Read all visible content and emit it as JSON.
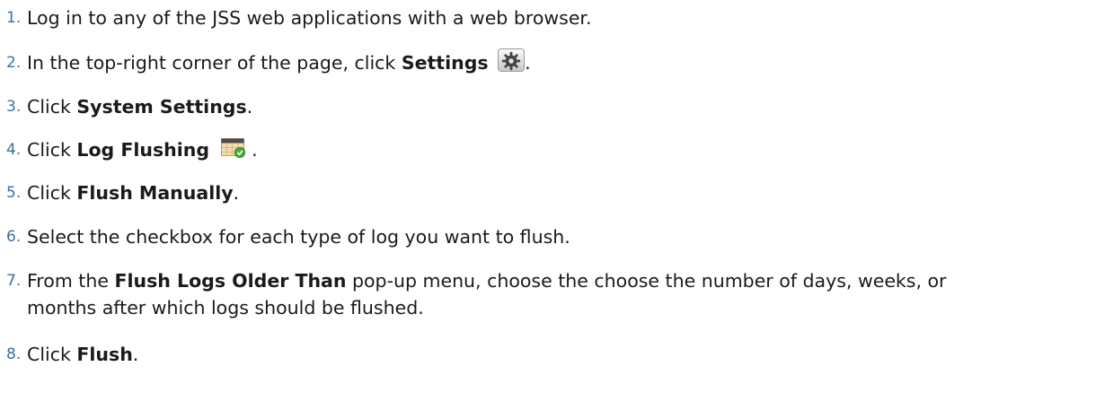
{
  "steps": [
    {
      "num": "1.",
      "parts": [
        "Log in to any of the JSS web applications with a web browser."
      ]
    },
    {
      "num": "2.",
      "pre": "In the top-right corner of the page, click ",
      "bold": "Settings",
      "icon": "gear-icon",
      "post": "."
    },
    {
      "num": "3.",
      "pre": "Click ",
      "bold": "System Settings",
      "post": "."
    },
    {
      "num": "4.",
      "pre": "Click ",
      "bold": "Log Flushing",
      "icon": "calendar-check-icon",
      "post": "."
    },
    {
      "num": "5.",
      "pre": "Click ",
      "bold": "Flush Manually",
      "post": "."
    },
    {
      "num": "6.",
      "text": "Select the checkbox for each type of log you want to flush."
    },
    {
      "num": "7.",
      "pre": "From the ",
      "bold": "Flush Logs Older Than",
      "post_line1": " pop-up menu, choose the choose the number of days, weeks, or",
      "post_line2": "months after which logs should be flushed."
    },
    {
      "num": "8.",
      "pre": "Click ",
      "bold": "Flush",
      "post": "."
    }
  ],
  "icons": {
    "settings": "gear-icon",
    "log_flushing": "calendar-check-icon"
  },
  "colors": {
    "number": "#3a6fa5",
    "text": "#1a1a1a"
  }
}
